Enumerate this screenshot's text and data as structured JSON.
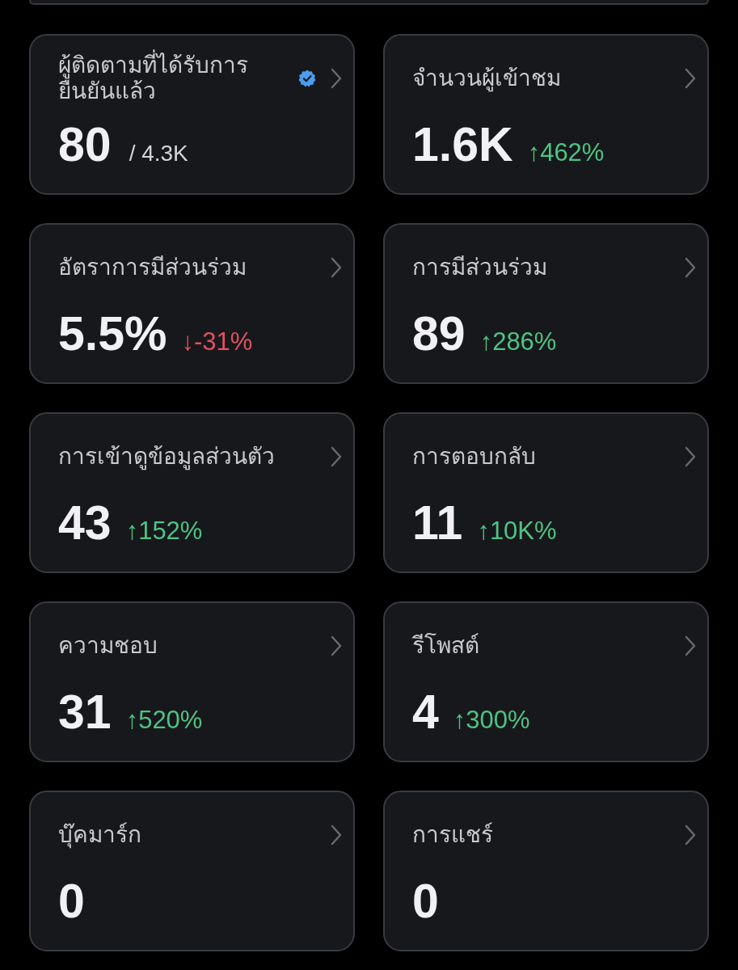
{
  "cards": [
    {
      "title": "ผู้ติดตามที่ได้รับการยืนยันแล้ว",
      "verified": true,
      "value": "80",
      "total": "/ 4.3K"
    },
    {
      "title": "จำนวนผู้เข้าชม",
      "verified": false,
      "value": "1.6K",
      "change": {
        "kind": "increase",
        "text": "↑462%"
      }
    },
    {
      "title": "อัตราการมีส่วนร่วม",
      "verified": false,
      "value": "5.5%",
      "change": {
        "kind": "decrease",
        "text": "↓-31%"
      }
    },
    {
      "title": "การมีส่วนร่วม",
      "verified": false,
      "value": "89",
      "change": {
        "kind": "increase",
        "text": "↑286%"
      }
    },
    {
      "title": "การเข้าดูข้อมูลส่วนตัว",
      "verified": false,
      "value": "43",
      "change": {
        "kind": "increase",
        "text": "↑152%"
      }
    },
    {
      "title": "การตอบกลับ",
      "verified": false,
      "value": "11",
      "change": {
        "kind": "increase",
        "text": "↑10K%"
      }
    },
    {
      "title": "ความชอบ",
      "verified": false,
      "value": "31",
      "change": {
        "kind": "increase",
        "text": "↑520%"
      }
    },
    {
      "title": "รีโพสต์",
      "verified": false,
      "value": "4",
      "change": {
        "kind": "increase",
        "text": "↑300%"
      }
    },
    {
      "title": "บุ๊คมาร์ก",
      "verified": false,
      "value": "0"
    },
    {
      "title": "การแชร์",
      "verified": false,
      "value": "0"
    }
  ]
}
